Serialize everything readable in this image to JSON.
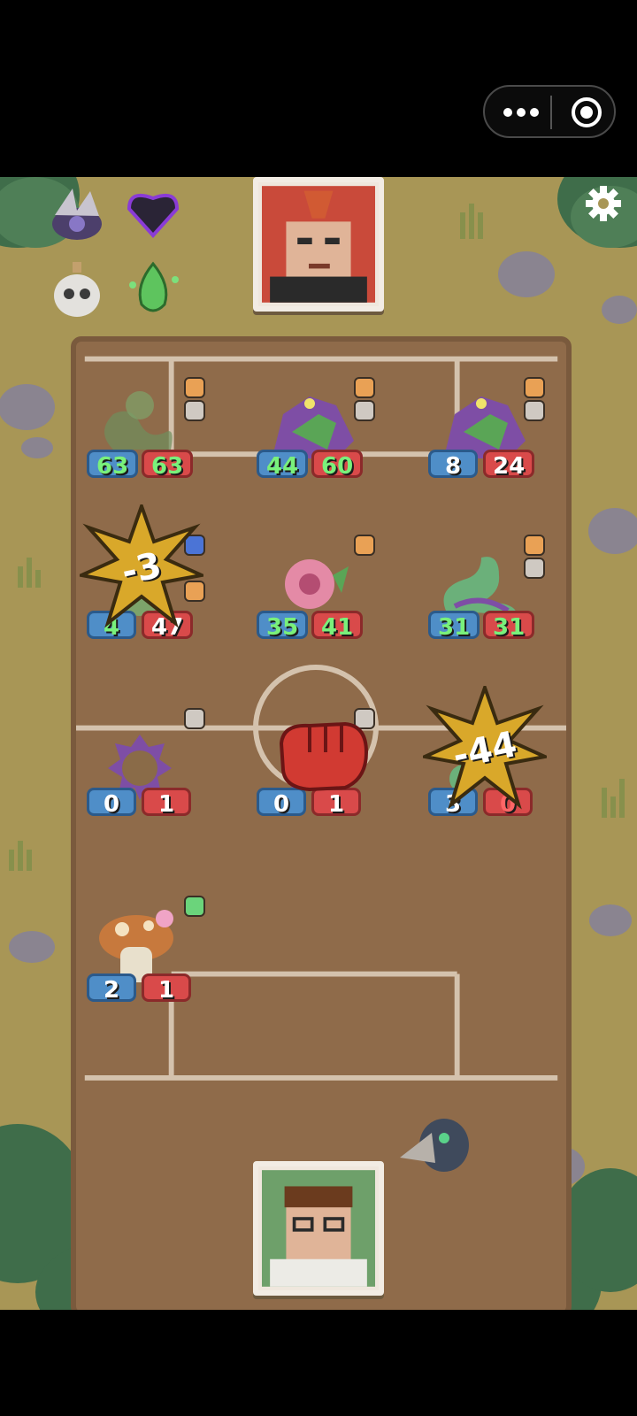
{
  "ui": {
    "capsule_label": "mini-program controls"
  },
  "board": {
    "units": [
      {
        "id": "e1",
        "name": "snake",
        "atk": "63",
        "hp": "63"
      },
      {
        "id": "e2",
        "name": "purple-dragon",
        "atk": "44",
        "hp": "60"
      },
      {
        "id": "e3",
        "name": "purple-dragon-2",
        "atk": "8",
        "hp": "24"
      },
      {
        "id": "m1",
        "name": "hidden-unit",
        "atk": "4",
        "hp": "47",
        "damage": "-3"
      },
      {
        "id": "m2",
        "name": "pink-flower-monster",
        "atk": "35",
        "hp": "41"
      },
      {
        "id": "m3",
        "name": "snake-2",
        "atk": "31",
        "hp": "31"
      },
      {
        "id": "p1",
        "name": "spiky-seed",
        "atk": "0",
        "hp": "1"
      },
      {
        "id": "p2",
        "name": "spiky-seed-2",
        "atk": "0",
        "hp": "1"
      },
      {
        "id": "p3",
        "name": "hit-unit",
        "atk": "3",
        "hp": "0",
        "damage": "-44"
      },
      {
        "id": "p4",
        "name": "mushroom",
        "atk": "2",
        "hp": "1"
      }
    ]
  },
  "colors": {
    "grass": "#a89656",
    "dirt": "#8f6b4a",
    "atk_badge": "#4f8ec8",
    "hp_badge": "#d94a4a",
    "burst": "#d9a82a"
  }
}
